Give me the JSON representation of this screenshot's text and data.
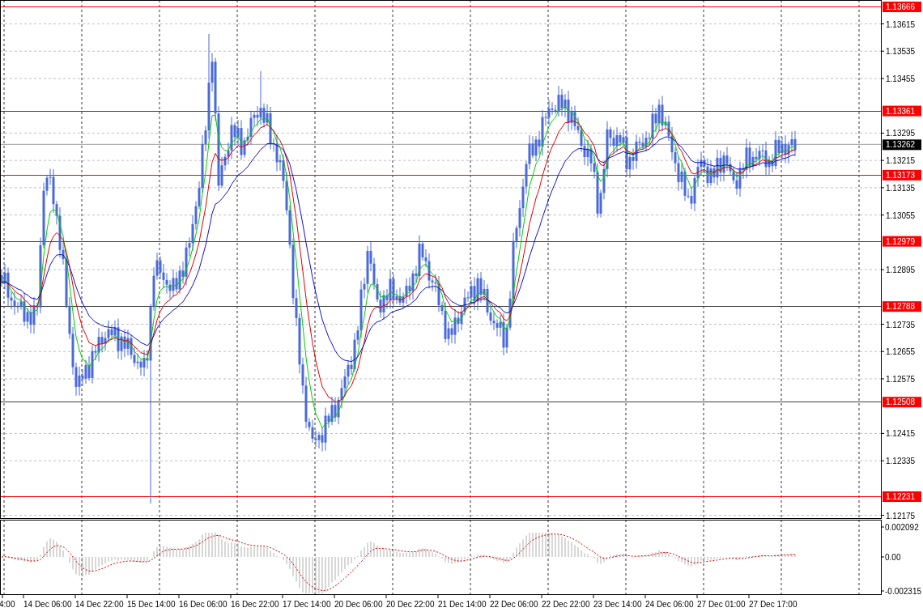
{
  "price_axis": {
    "ticks": [
      "1.13615",
      "1.13535",
      "1.13455",
      "1.13295",
      "1.13215",
      "1.13135",
      "1.13055",
      "1.12895",
      "1.12735",
      "1.12655",
      "1.12575",
      "1.12415",
      "1.12335",
      "1.12175"
    ]
  },
  "levels": [
    {
      "label": "1.13666",
      "color": "#ff0000"
    },
    {
      "label": "1.13361",
      "color": "#404040"
    },
    {
      "label": "1.13173",
      "color": "#ff0000"
    },
    {
      "label": "1.12979",
      "color": "#404040"
    },
    {
      "label": "1.12788",
      "color": "#404040"
    },
    {
      "label": "1.12508",
      "color": "#404040"
    },
    {
      "label": "1.12231",
      "color": "#ff0000"
    }
  ],
  "current_price": "1.13262",
  "indicator": {
    "ticks": [
      "0.002092",
      "0.00",
      "-0.002315"
    ]
  },
  "time_axis": {
    "labels": [
      "4:00",
      "14 Dec 06:00",
      "14 Dec 22:00",
      "15 Dec 14:00",
      "16 Dec 06:00",
      "16 Dec 22:00",
      "17 Dec 14:00",
      "20 Dec 06:00",
      "20 Dec 22:00",
      "21 Dec 14:00",
      "22 Dec 06:00",
      "22 Dec 22:00",
      "23 Dec 14:00",
      "24 Dec 06:00",
      "27 Dec 01:00",
      "27 Dec 17:00"
    ]
  }
}
